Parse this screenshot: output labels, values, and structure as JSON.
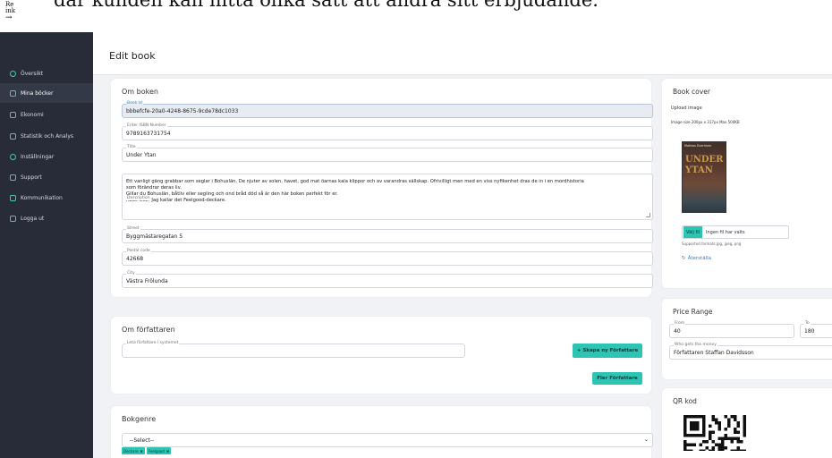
{
  "top": {
    "caption": "där kunden kan hitta olika sätt att ändra sitt erbjudande.",
    "logo_line1": "Re",
    "logo_line2": "ink",
    "logo_arrow": "→"
  },
  "sidebar": {
    "items": [
      {
        "label": "Översikt",
        "icon": "dashboard-icon"
      },
      {
        "label": "Mina böcker",
        "icon": "book-icon",
        "active": true
      },
      {
        "label": "Ekonomi",
        "icon": "wallet-icon"
      },
      {
        "label": "Statistik och Analys",
        "icon": "chart-icon"
      },
      {
        "label": "Inställningar",
        "icon": "gear-icon"
      },
      {
        "label": "Support",
        "icon": "support-icon"
      },
      {
        "label": "Kommunikation",
        "icon": "chat-icon"
      },
      {
        "label": "Logga ut",
        "icon": "logout-icon"
      }
    ]
  },
  "header": {
    "title": "Edit book"
  },
  "om_boken": {
    "title": "Om boken",
    "book_id": {
      "label": "Book id",
      "value": "bbbefcfe-20a0-4248-8675-9cde78dc1033"
    },
    "isbn": {
      "label": "Enter ISBN Number",
      "value": "9789163731754"
    },
    "book_title": {
      "label": "Title",
      "value": "Under Ytan"
    },
    "description": {
      "label": "Description",
      "line1": "Ett vanligt gäng grabbar som seglar i Bohuslän. De njuter av solen, havet, god mat  öarnas kala klippor och av varandras sällskap. Ofrivilligt men med en viss nyfikenhet dras de in i en mordhistoria",
      "line2": "som förändrar deras liv.",
      "line3": "Gillar du Bohuslän, båtliv eller segling och ond bråd död så är den här boken perfekt för er.",
      "line4": "Räds icke!  Jag kallar det Feelgood-deckare."
    },
    "street": {
      "label": "Street",
      "value": "Byggmästaregatan 5"
    },
    "postal": {
      "label": "Postal code",
      "value": "42668"
    },
    "city": {
      "label": "City",
      "value": "Västra Frölunda"
    }
  },
  "om_forfattaren": {
    "title": "Om författaren",
    "search": {
      "label": "Leta författare i systemet",
      "value": ""
    },
    "create_button": "+ Skapa ny Författare",
    "more_button": "Fler Författare"
  },
  "bokgenre": {
    "title": "Bokgenre",
    "select_value": "--Select--",
    "tags": [
      "Deckare",
      "Feelgood"
    ],
    "tag_close": "✖"
  },
  "book_cover": {
    "title": "Book cover",
    "upload_label": "Upload image",
    "size_hint": "Image size 200px x 317px Max 500KB",
    "cover_author": "Mattias Everhinin",
    "cover_title_1": "UNDER",
    "cover_title_2": "YTAN",
    "file_button": "Välj fil",
    "file_name": "Ingen fil har valts",
    "formats": "Supported formats:jpg, jpeg, png",
    "reset_label": "Återställa"
  },
  "price_range": {
    "title": "Price Range",
    "from": {
      "label": "From",
      "value": "40"
    },
    "to": {
      "label": "To",
      "value": "180"
    },
    "who": {
      "label": "Who gets the money",
      "value": "Författaren Staffan Davidsson"
    }
  },
  "qr": {
    "title": "QR kod"
  },
  "colors": {
    "accent": "#2ec4b4",
    "sidebar_bg": "#282c38",
    "link": "#2f7fd6"
  }
}
